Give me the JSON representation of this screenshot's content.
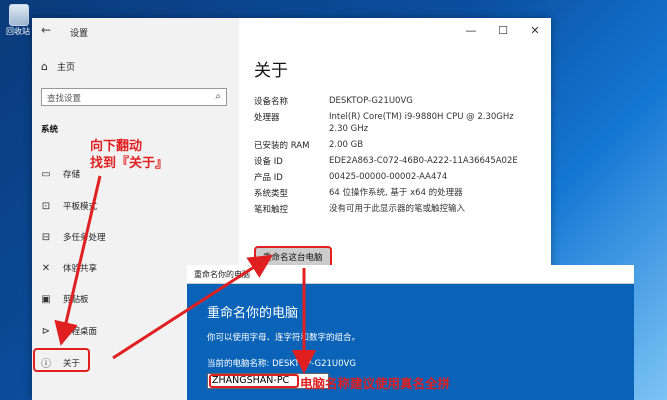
{
  "desktop": {
    "recycle_label": "回收站"
  },
  "window": {
    "title": "设置",
    "back": "←",
    "min": "—",
    "max": "☐",
    "close": "✕"
  },
  "sidebar": {
    "home": "主页",
    "search_placeholder": "查找设置",
    "section": "系统",
    "items": [
      {
        "label": "存储",
        "icon": "storage-icon",
        "glyph": "▭"
      },
      {
        "label": "平板模式",
        "icon": "tablet-mode-icon",
        "glyph": "⊡"
      },
      {
        "label": "多任务处理",
        "icon": "multitasking-icon",
        "glyph": "⊟"
      },
      {
        "label": "体验共享",
        "icon": "shared-experiences-icon",
        "glyph": "✕"
      },
      {
        "label": "剪贴板",
        "icon": "clipboard-icon",
        "glyph": "▣"
      },
      {
        "label": "远程桌面",
        "icon": "remote-desktop-icon",
        "glyph": "⊳"
      },
      {
        "label": "关于",
        "icon": "about-icon",
        "glyph": "ⓘ"
      }
    ]
  },
  "content": {
    "title": "关于",
    "specs": [
      {
        "k": "设备名称",
        "v": "DESKTOP-G21U0VG"
      },
      {
        "k": "处理器",
        "v": "Intel(R) Core(TM) i9-9880H CPU @ 2.30GHz   2.30 GHz"
      },
      {
        "k": "已安装的 RAM",
        "v": "2.00 GB"
      },
      {
        "k": "设备 ID",
        "v": "EDE2A863-C072-46B0-A222-11A36645A02E"
      },
      {
        "k": "产品 ID",
        "v": "00425-00000-00002-AA474"
      },
      {
        "k": "系统类型",
        "v": "64 位操作系统, 基于 x64 的处理器"
      },
      {
        "k": "笔和触控",
        "v": "没有可用于此显示器的笔或触控输入"
      }
    ],
    "rename_button": "重命名这台电脑"
  },
  "dialog": {
    "title": "重命名你的电脑",
    "heading": "重命名你的电脑",
    "desc": "你可以使用字母、连字符和数字的组合。",
    "current": "当前的电脑名称: DESKTOP-G21U0VG",
    "input_value": "ZHANGSHAN-PC"
  },
  "annotations": {
    "scroll_line1": "向下翻动",
    "scroll_line2": "找到『关于』",
    "name_note": "电脑名称建议使用真名全拼",
    "color": "#e02020"
  }
}
